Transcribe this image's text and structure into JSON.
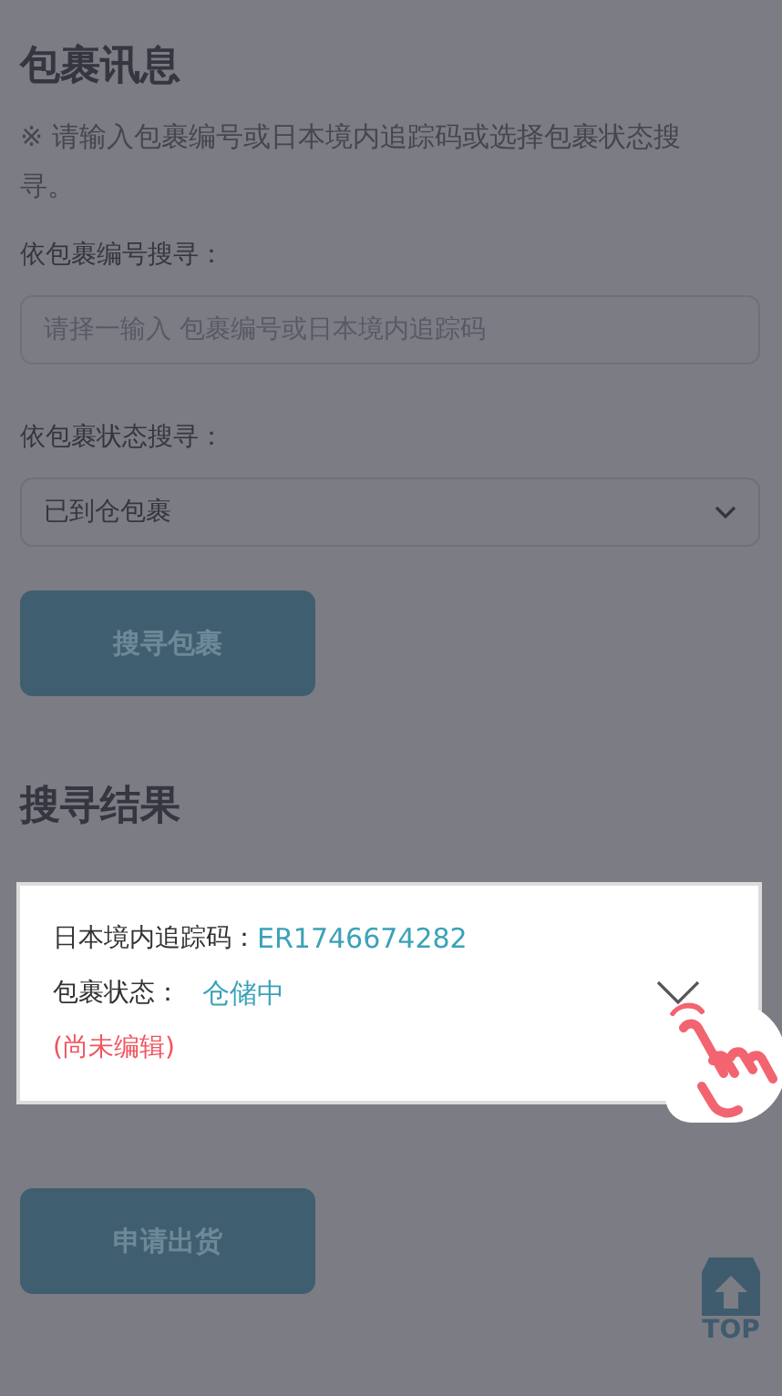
{
  "section_title": "包裹讯息",
  "hint": "※ 请输入包裹编号或日本境内追踪码或选择包裹状态搜寻。",
  "number_search": {
    "label": "依包裹编号搜寻：",
    "placeholder": "请择一输入 包裹编号或日本境内追踪码"
  },
  "status_search": {
    "label": "依包裹状态搜寻：",
    "value": "已到仓包裹"
  },
  "search_button": "搜寻包裹",
  "results_title": "搜寻结果",
  "results": [
    {
      "tracking_label": "日本境内追踪码：",
      "tracking": "ER1746674282",
      "status_label": "包裹状态：",
      "status": "仓储中",
      "note": "(尚未编辑)",
      "expanded": false
    }
  ],
  "ship_button": "申请出货",
  "top_button": "TOP"
}
